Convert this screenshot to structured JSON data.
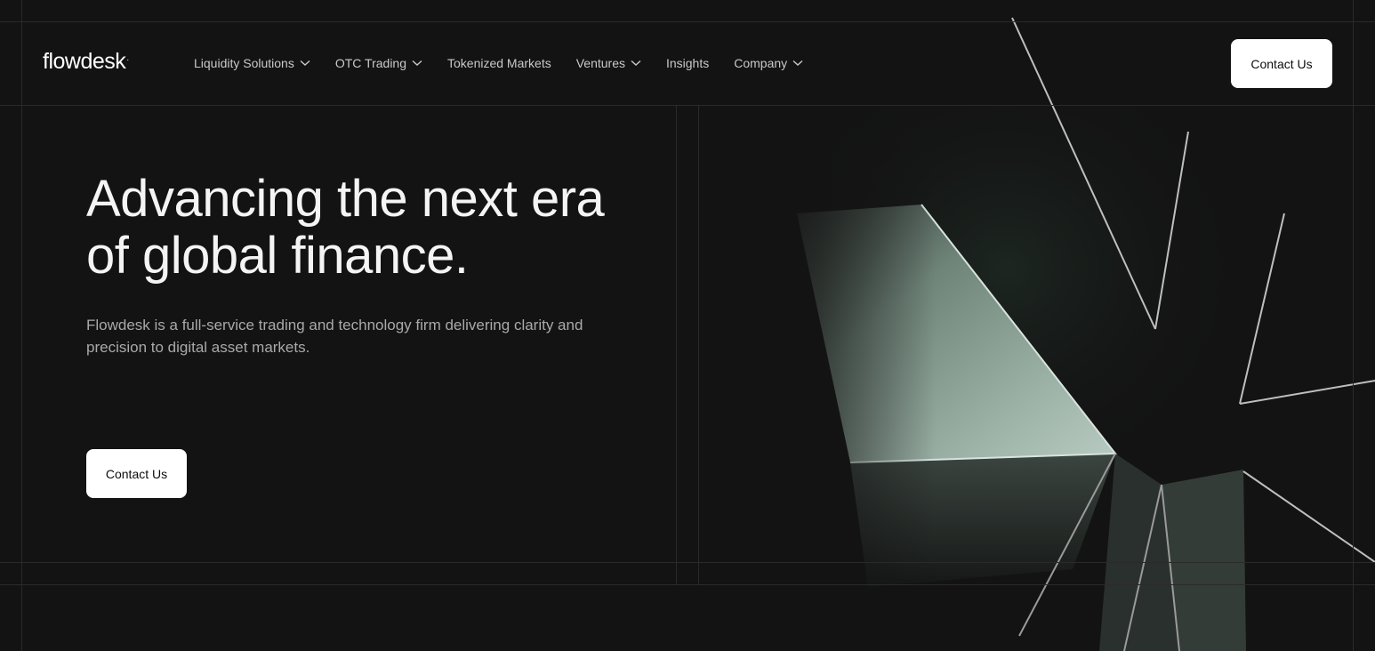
{
  "brand": {
    "name": "flowdesk",
    "mark": "·"
  },
  "nav": {
    "items": [
      {
        "label": "Liquidity Solutions",
        "has_dropdown": true
      },
      {
        "label": "OTC Trading",
        "has_dropdown": true
      },
      {
        "label": "Tokenized Markets",
        "has_dropdown": false
      },
      {
        "label": "Ventures",
        "has_dropdown": true
      },
      {
        "label": "Insights",
        "has_dropdown": false
      },
      {
        "label": "Company",
        "has_dropdown": true
      }
    ],
    "contact_label": "Contact Us"
  },
  "hero": {
    "title": "Advancing the next era of global finance.",
    "subtitle": "Flowdesk is a full-service trading and technology firm delivering clarity and precision to digital asset markets.",
    "cta_label": "Contact Us"
  },
  "colors": {
    "background": "#131313",
    "accent_surface": "#8ea59a",
    "button_bg": "#ffffff",
    "text_muted": "#a9a9a9"
  }
}
